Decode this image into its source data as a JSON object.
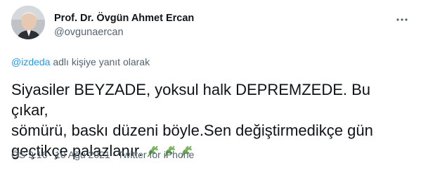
{
  "author": {
    "display_name": "Prof. Dr. Övgün Ahmet Ercan",
    "handle": "@ovgunaercan"
  },
  "reply_context": {
    "mention": "@izdeda",
    "suffix": " adlı kişiye yanıt olarak"
  },
  "tweet": {
    "line1": "Siyasiler BEYZADE, yoksul halk DEPREMZEDE. Bu çıkar,",
    "line2": "sömürü, baskı düzeni böyle.Sen değiştirmedikçe gün",
    "line3": "geçtikçe palazlanır.",
    "emoji": [
      "herb-emoji",
      "herb-emoji",
      "herb-emoji"
    ]
  },
  "meta": {
    "time": "ÖS 9:16",
    "date": "10 Ağu 2021",
    "source": "Twitter for iPhone",
    "separator": "·"
  },
  "colors": {
    "text": "#0f1419",
    "secondary": "#536471",
    "link": "#1d9bf0",
    "herb_green": "#6aa84f"
  }
}
